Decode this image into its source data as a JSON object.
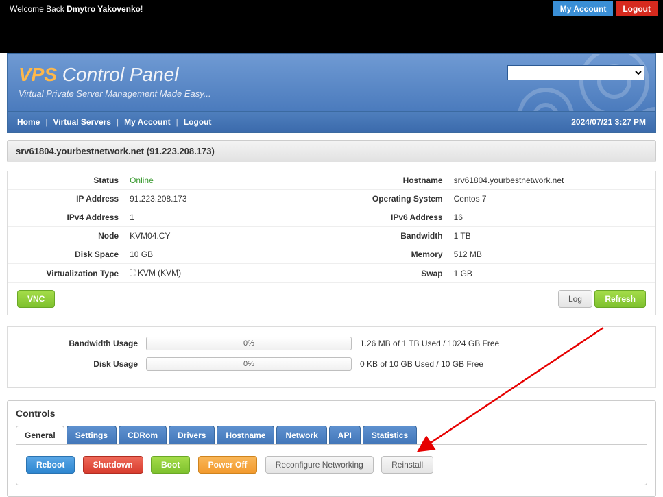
{
  "topbar": {
    "welcome_prefix": "Welcome Back ",
    "user_name": "Dmytro Yakovenko",
    "exclaim": "!",
    "my_account": "My Account",
    "logout": "Logout"
  },
  "header": {
    "vps": "VPS",
    "title_rest": " Control Panel",
    "subtitle": "Virtual Private Server Management Made Easy..."
  },
  "nav": {
    "home": "Home",
    "virtual_servers": "Virtual Servers",
    "my_account": "My Account",
    "logout": "Logout",
    "datetime": "2024/07/21 3:27 PM"
  },
  "server_title": "srv61804.yourbestnetwork.net (91.223.208.173)",
  "info": {
    "labels": {
      "status": "Status",
      "ip_address": "IP Address",
      "ipv4_address": "IPv4 Address",
      "node": "Node",
      "disk_space": "Disk Space",
      "virt_type": "Virtualization Type",
      "hostname": "Hostname",
      "os": "Operating System",
      "ipv6_address": "IPv6 Address",
      "bandwidth": "Bandwidth",
      "memory": "Memory",
      "swap": "Swap"
    },
    "values": {
      "status": "Online",
      "ip_address": "91.223.208.173",
      "ipv4_address": "1",
      "node": "KVM04.CY",
      "disk_space": "10 GB",
      "virt_type": "KVM  (KVM)",
      "hostname": "srv61804.yourbestnetwork.net",
      "os": "Centos 7",
      "ipv6_address": "16",
      "bandwidth": "1 TB",
      "memory": "512 MB",
      "swap": "1 GB"
    }
  },
  "actions": {
    "vnc": "VNC",
    "log": "Log",
    "refresh": "Refresh"
  },
  "usage": {
    "bw_label": "Bandwidth Usage",
    "bw_percent": "0%",
    "bw_text": "1.26 MB of 1 TB Used / 1024 GB Free",
    "disk_label": "Disk Usage",
    "disk_percent": "0%",
    "disk_text": "0 KB of 10 GB Used / 10 GB Free"
  },
  "controls": {
    "title": "Controls",
    "tabs": {
      "general": "General",
      "settings": "Settings",
      "cdrom": "CDRom",
      "drivers": "Drivers",
      "hostname": "Hostname",
      "network": "Network",
      "api": "API",
      "statistics": "Statistics"
    },
    "buttons": {
      "reboot": "Reboot",
      "shutdown": "Shutdown",
      "boot": "Boot",
      "poweroff": "Power Off",
      "reconfigure": "Reconfigure Networking",
      "reinstall": "Reinstall"
    }
  }
}
